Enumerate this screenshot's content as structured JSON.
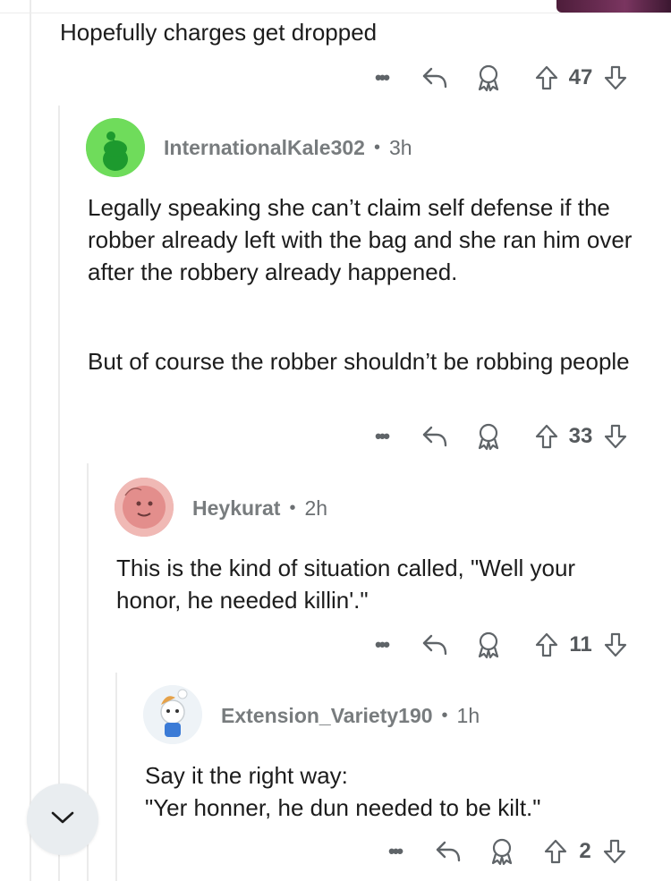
{
  "top_comment": {
    "text": "Hopefully charges get dropped",
    "votes": "47"
  },
  "comments": [
    {
      "username": "InternationalKale302",
      "age": "3h",
      "avatar_color": "#6fdc5b",
      "paragraphs": [
        "Legally speaking she can’t claim self defense if the robber already left with the bag and she ran him over after the robbery already happened.",
        "But of course the robber shouldn’t be robbing people"
      ],
      "votes": "33"
    },
    {
      "username": "Heykurat",
      "age": "2h",
      "avatar_color": "#e9a3a3",
      "paragraphs": [
        "This is the kind of situation called, \"Well your honor, he needed killin'.\""
      ],
      "votes": "11"
    },
    {
      "username": "Extension_Variety190",
      "age": "1h",
      "avatar_color": "#eef3f7",
      "paragraphs": [
        "Say it the right way:\n\"Yer honner, he dun needed to be kilt.\""
      ],
      "votes": "2"
    }
  ],
  "icons": {
    "more": "more-options-icon",
    "reply": "reply-icon",
    "award": "award-icon",
    "upvote": "upvote-icon",
    "downvote": "downvote-icon",
    "collapse": "chevron-down-icon"
  },
  "more_glyph": "•••"
}
